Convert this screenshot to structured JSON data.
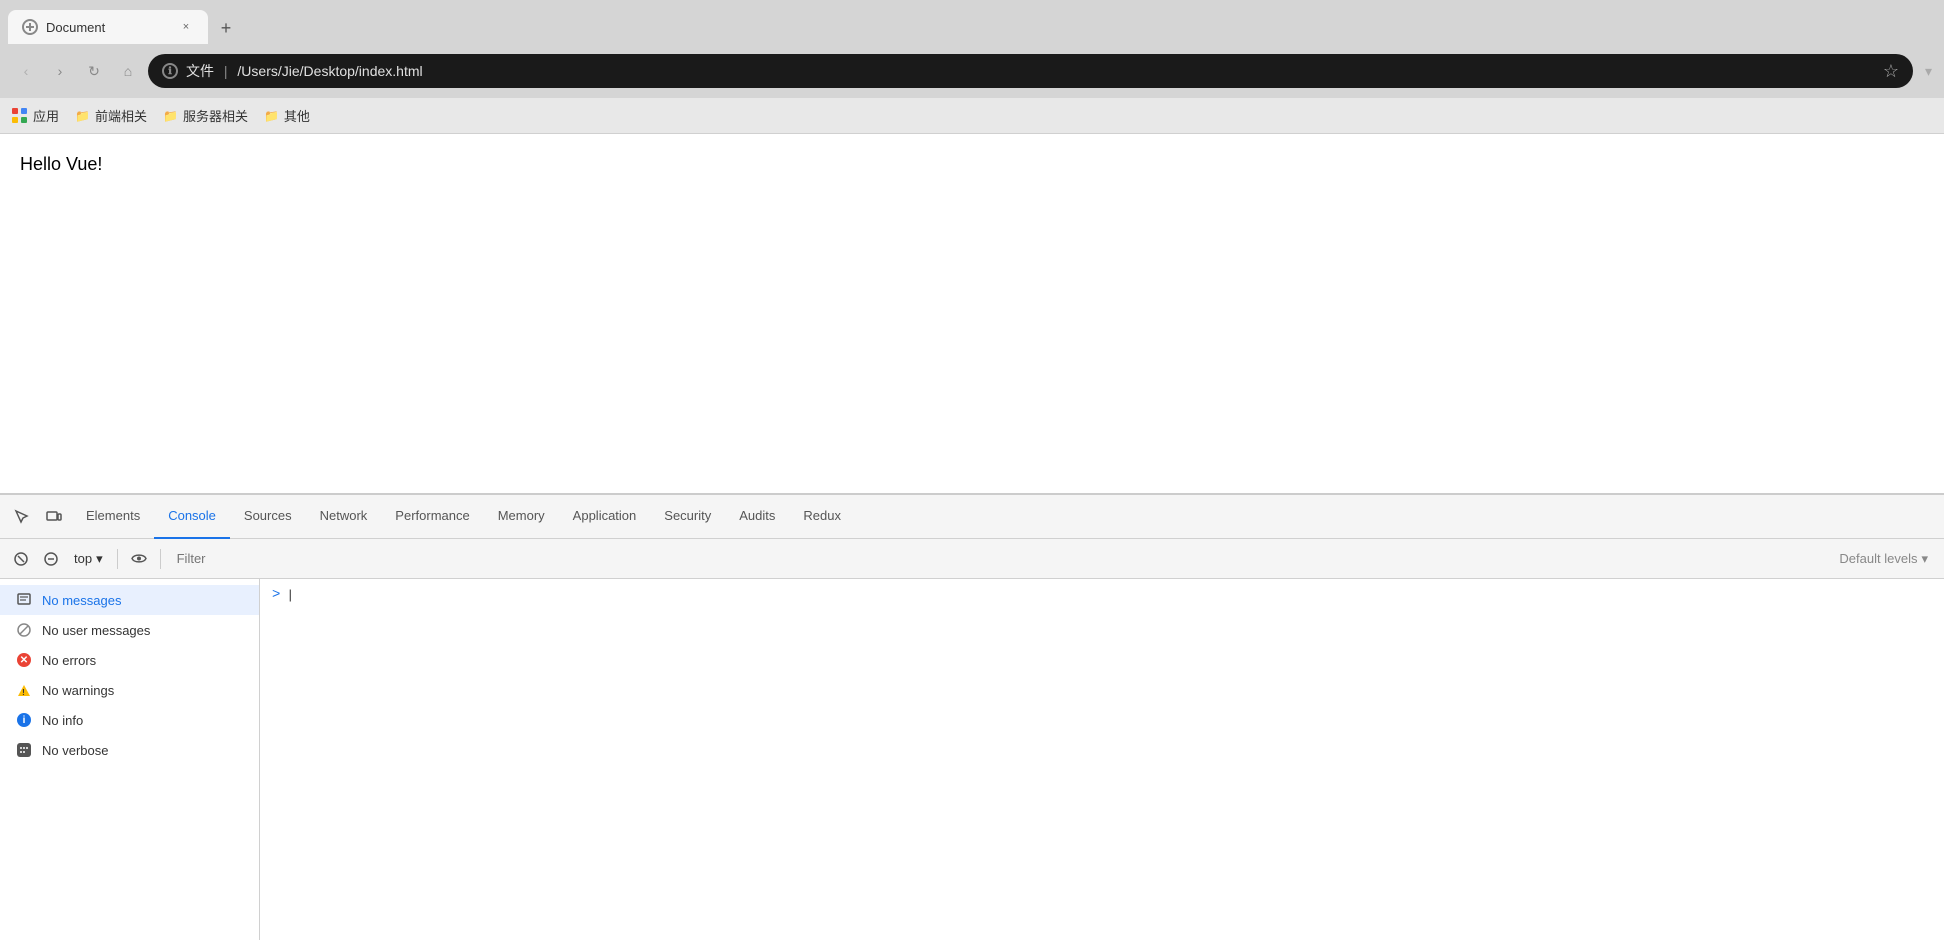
{
  "browser": {
    "tab": {
      "title": "Document",
      "close_label": "×"
    },
    "new_tab_label": "+",
    "nav": {
      "back_label": "‹",
      "forward_label": "›",
      "reload_label": "↻",
      "home_label": "⌂",
      "address": {
        "protocol": "文件",
        "separator": "|",
        "path": "/Users/Jie/Desktop/index.html"
      },
      "star_label": "☆",
      "chevron_label": "▾"
    },
    "bookmarks": [
      {
        "id": "apps",
        "label": "应用",
        "type": "grid"
      },
      {
        "id": "frontend",
        "label": "前端相关",
        "type": "folder"
      },
      {
        "id": "server",
        "label": "服务器相关",
        "type": "folder"
      },
      {
        "id": "other",
        "label": "其他",
        "type": "folder"
      }
    ]
  },
  "page": {
    "content": "Hello Vue!"
  },
  "devtools": {
    "tabs": [
      {
        "id": "elements",
        "label": "Elements"
      },
      {
        "id": "console",
        "label": "Console"
      },
      {
        "id": "sources",
        "label": "Sources"
      },
      {
        "id": "network",
        "label": "Network"
      },
      {
        "id": "performance",
        "label": "Performance"
      },
      {
        "id": "memory",
        "label": "Memory"
      },
      {
        "id": "application",
        "label": "Application"
      },
      {
        "id": "security",
        "label": "Security"
      },
      {
        "id": "audits",
        "label": "Audits"
      },
      {
        "id": "redux",
        "label": "Redux"
      }
    ],
    "active_tab": "console",
    "toolbar": {
      "context": "top",
      "filter_placeholder": "Filter",
      "levels_label": "Default levels",
      "levels_arrow": "▾"
    },
    "sidebar": {
      "items": [
        {
          "id": "messages",
          "label": "No messages",
          "icon": "messages"
        },
        {
          "id": "user",
          "label": "No user messages",
          "icon": "user-ban"
        },
        {
          "id": "errors",
          "label": "No errors",
          "icon": "error"
        },
        {
          "id": "warnings",
          "label": "No warnings",
          "icon": "warning"
        },
        {
          "id": "info",
          "label": "No info",
          "icon": "info"
        },
        {
          "id": "verbose",
          "label": "No verbose",
          "icon": "verbose"
        }
      ]
    },
    "console": {
      "prompt_symbol": ">",
      "cursor": "|"
    }
  }
}
